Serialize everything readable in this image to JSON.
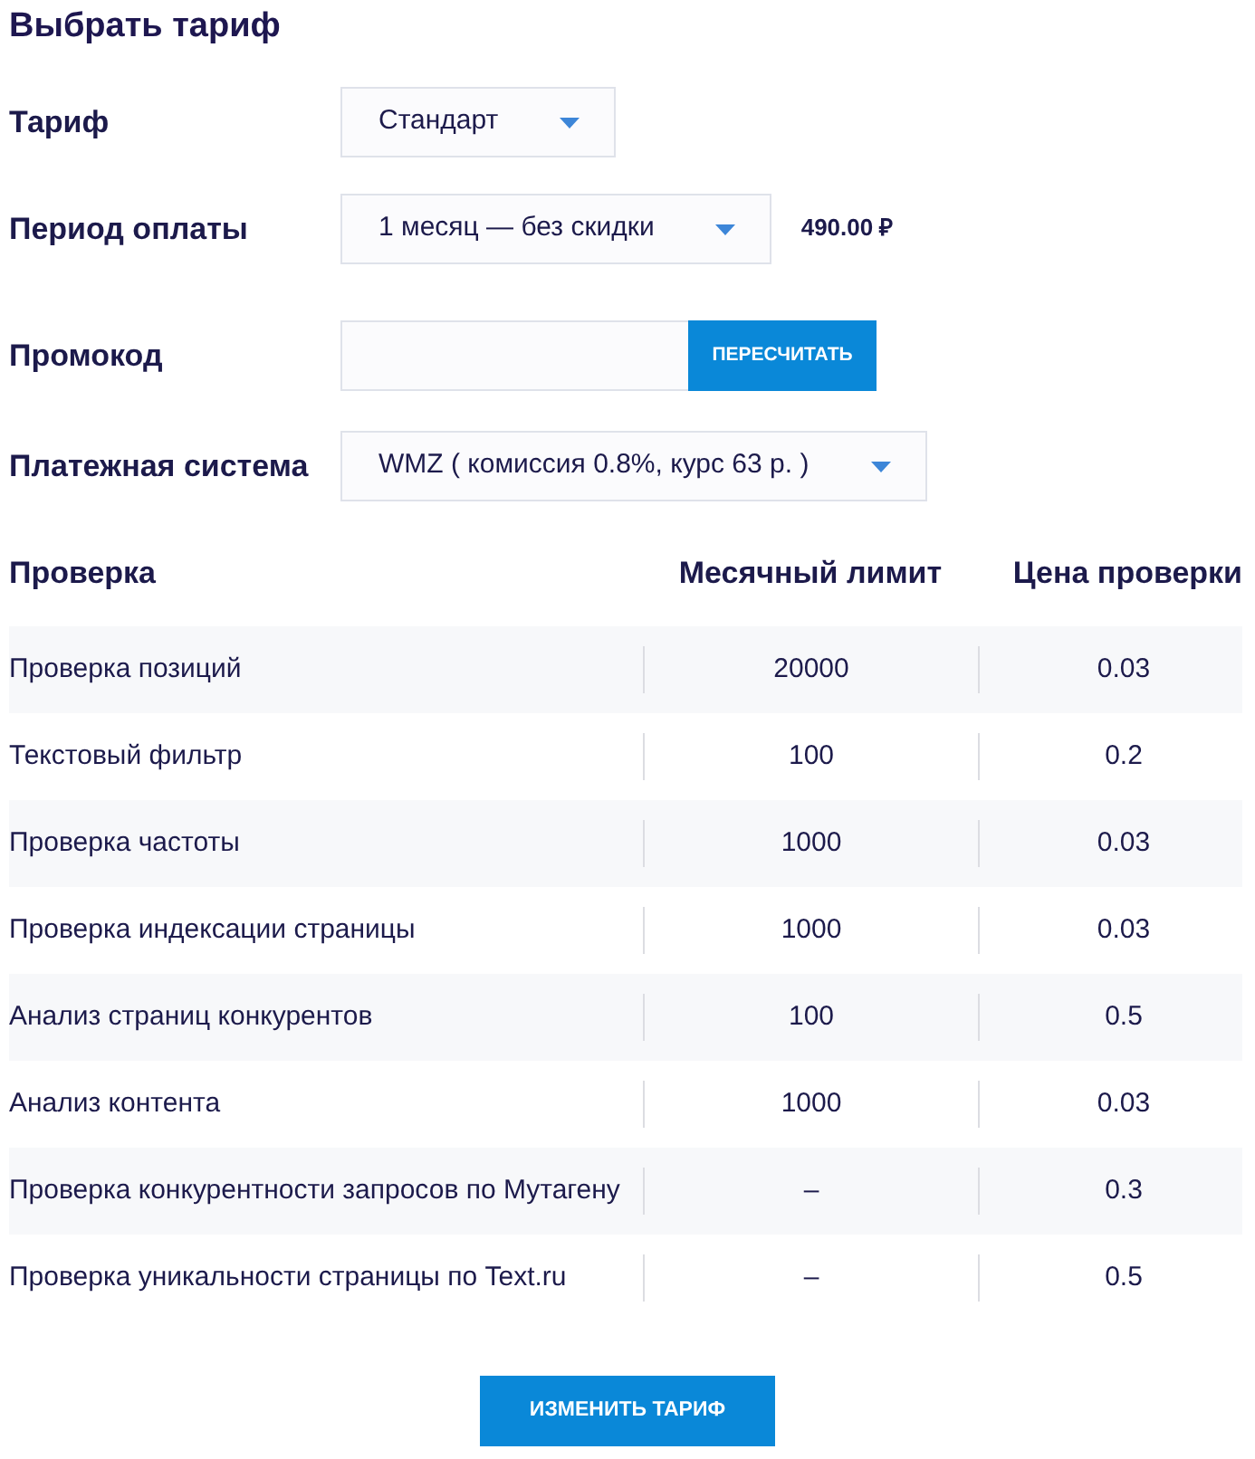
{
  "title": "Выбрать тариф",
  "form": [
    {
      "kind": "select",
      "label": "Тариф",
      "value": "Стандарт"
    },
    {
      "kind": "select",
      "label": "Период оплаты",
      "value": "1 месяц — без скидки",
      "price": "490.00 ₽"
    },
    {
      "kind": "input",
      "label": "Промокод",
      "button": "ПЕРЕСЧИТАТЬ"
    },
    {
      "kind": "select",
      "label": "Платежная система",
      "value": "WMZ ( комиссия 0.8%, курс 63 р. )"
    }
  ],
  "table": {
    "columns": [
      "Проверка",
      "Месячный лимит",
      "Цена проверки"
    ],
    "rows": [
      [
        "Проверка позиций",
        "20000",
        "0.03"
      ],
      [
        "Текстовый фильтр",
        "100",
        "0.2"
      ],
      [
        "Проверка частоты",
        "1000",
        "0.03"
      ],
      [
        "Проверка индексации страницы",
        "1000",
        "0.03"
      ],
      [
        "Анализ страниц конкурентов",
        "100",
        "0.5"
      ],
      [
        "Анализ контента",
        "1000",
        "0.03"
      ],
      [
        "Проверка конкурентности запросов по Мутагену",
        "–",
        "0.3"
      ],
      [
        "Проверка уникальности страницы по Text.ru",
        "–",
        "0.5"
      ]
    ]
  },
  "submit_button": "ИЗМЕНИТЬ ТАРИФ"
}
